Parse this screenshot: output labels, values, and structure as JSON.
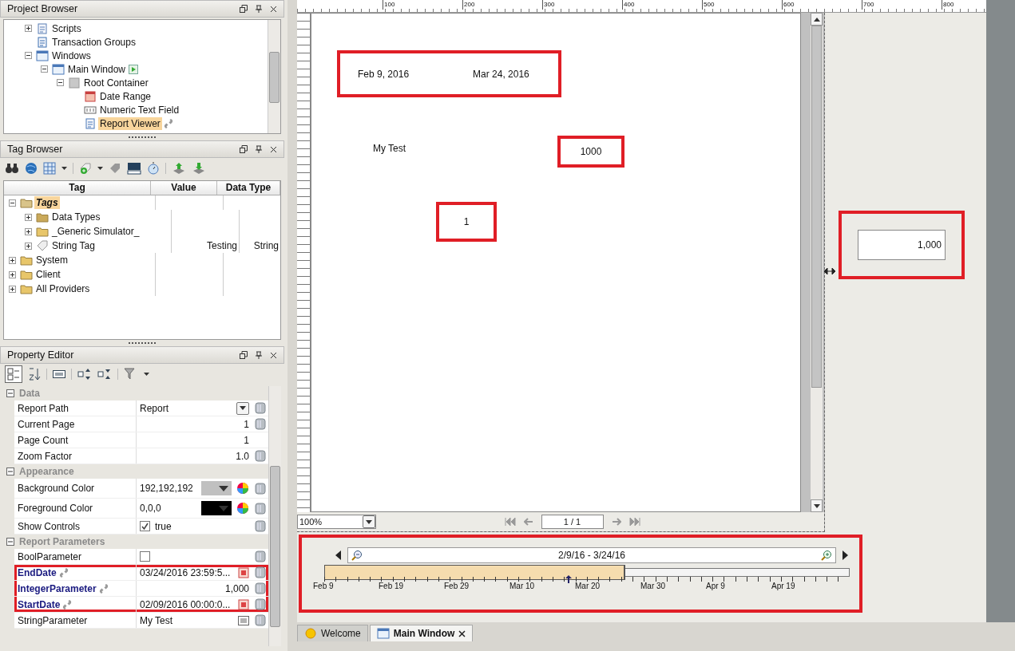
{
  "project_browser": {
    "title": "Project Browser",
    "tree": [
      {
        "label": "Scripts",
        "kind": "scripts",
        "expanded": false,
        "selected": false
      },
      {
        "label": "Transaction Groups",
        "kind": "groups",
        "selected": false
      },
      {
        "label": "Windows",
        "kind": "windows",
        "expanded": true,
        "selected": false,
        "children": [
          {
            "label": "Main Window",
            "kind": "window",
            "expanded": true,
            "selected": false,
            "startup": true,
            "children": [
              {
                "label": "Root Container",
                "kind": "container",
                "expanded": true,
                "selected": false,
                "children": [
                  {
                    "label": "Date Range",
                    "kind": "daterange",
                    "selected": false
                  },
                  {
                    "label": "Numeric Text Field",
                    "kind": "numeric",
                    "selected": false
                  },
                  {
                    "label": "Report Viewer",
                    "kind": "report",
                    "selected": true,
                    "linked": true
                  }
                ]
              }
            ]
          }
        ]
      }
    ]
  },
  "tag_browser": {
    "title": "Tag Browser",
    "columns": [
      "Tag",
      "Value",
      "Data Type"
    ],
    "tree": [
      {
        "label": "Tags",
        "kind": "provider",
        "expanded": true,
        "selected": true,
        "children": [
          {
            "label": "Data Types",
            "kind": "datatypes",
            "expanded": false,
            "selected": false
          },
          {
            "label": "_Generic Simulator_",
            "kind": "folder",
            "expanded": false,
            "selected": false
          },
          {
            "label": "String Tag",
            "kind": "tag",
            "expanded": false,
            "selected": false,
            "value": "Testing",
            "data_type": "String"
          }
        ]
      },
      {
        "label": "System",
        "kind": "folder",
        "expanded": false,
        "selected": false
      },
      {
        "label": "Client",
        "kind": "folder",
        "expanded": false,
        "selected": false
      },
      {
        "label": "All Providers",
        "kind": "folder",
        "expanded": false,
        "selected": false
      }
    ]
  },
  "property_editor": {
    "title": "Property Editor",
    "groups": [
      {
        "name": "Data",
        "expanded": true,
        "properties": [
          {
            "name": "Report Path",
            "value": "Report",
            "kind": "dropdown",
            "bound": false,
            "bindable": true,
            "highlighted": false
          },
          {
            "name": "Current Page",
            "value": "1",
            "kind": "number",
            "bound": false,
            "bindable": true,
            "highlighted": false
          },
          {
            "name": "Page Count",
            "value": "1",
            "kind": "number",
            "bound": false,
            "bindable": false,
            "highlighted": false
          },
          {
            "name": "Zoom Factor",
            "value": "1.0",
            "kind": "number",
            "bound": false,
            "bindable": true,
            "highlighted": false
          }
        ]
      },
      {
        "name": "Appearance",
        "expanded": true,
        "properties": [
          {
            "name": "Background Color",
            "value": "192,192,192",
            "kind": "color",
            "color": "#c0c0c0",
            "bound": false,
            "bindable": true,
            "highlighted": false
          },
          {
            "name": "Foreground Color",
            "value": "0,0,0",
            "kind": "color",
            "color": "#000000",
            "bound": false,
            "bindable": true,
            "highlighted": false
          },
          {
            "name": "Show Controls",
            "value": "true",
            "kind": "checkbox",
            "checked": true,
            "bound": false,
            "bindable": true,
            "highlighted": false
          }
        ]
      },
      {
        "name": "Report Parameters",
        "expanded": true,
        "properties": [
          {
            "name": "BoolParameter",
            "kind": "checkbox",
            "checked": false,
            "bound": false,
            "bindable": true,
            "highlighted": false
          },
          {
            "name": "EndDate",
            "value": "03/24/2016 23:59:5...",
            "kind": "date",
            "bound": true,
            "bindable": true,
            "highlighted": true
          },
          {
            "name": "IntegerParameter",
            "value": "1,000",
            "kind": "number",
            "bound": true,
            "bindable": true,
            "highlighted": true
          },
          {
            "name": "StartDate",
            "value": "02/09/2016 00:00:0...",
            "kind": "date",
            "bound": true,
            "bindable": true,
            "highlighted": true
          },
          {
            "name": "StringParameter",
            "value": "My Test",
            "kind": "text",
            "bound": false,
            "bindable": true,
            "highlighted": false
          }
        ]
      }
    ]
  },
  "ruler": {
    "labels": [
      "100",
      "200",
      "300",
      "400",
      "500",
      "600",
      "700",
      "800"
    ]
  },
  "report": {
    "dates": {
      "start": "Feb 9, 2016",
      "end": "Mar 24, 2016",
      "highlighted": true
    },
    "label": "My Test",
    "value_box": {
      "text": "1000",
      "highlighted": true
    },
    "index_box": {
      "text": "1",
      "highlighted": true
    }
  },
  "report_controls": {
    "zoom": "100%",
    "page": "1 / 1"
  },
  "numeric_field": {
    "value": "1,000",
    "highlighted": true
  },
  "date_range": {
    "label": "2/9/16 - 3/24/16",
    "level": 0.57,
    "highlighted": true,
    "ticks": [
      "Feb 9",
      "Feb 19",
      "Feb 29",
      "Mar 10",
      "Mar 20",
      "Mar 30",
      "Apr 9",
      "Apr 19"
    ]
  },
  "tabs": [
    {
      "label": "Welcome",
      "kind": "welcome",
      "selected": false
    },
    {
      "label": "Main Window",
      "kind": "window",
      "selected": true,
      "closable": true
    }
  ]
}
